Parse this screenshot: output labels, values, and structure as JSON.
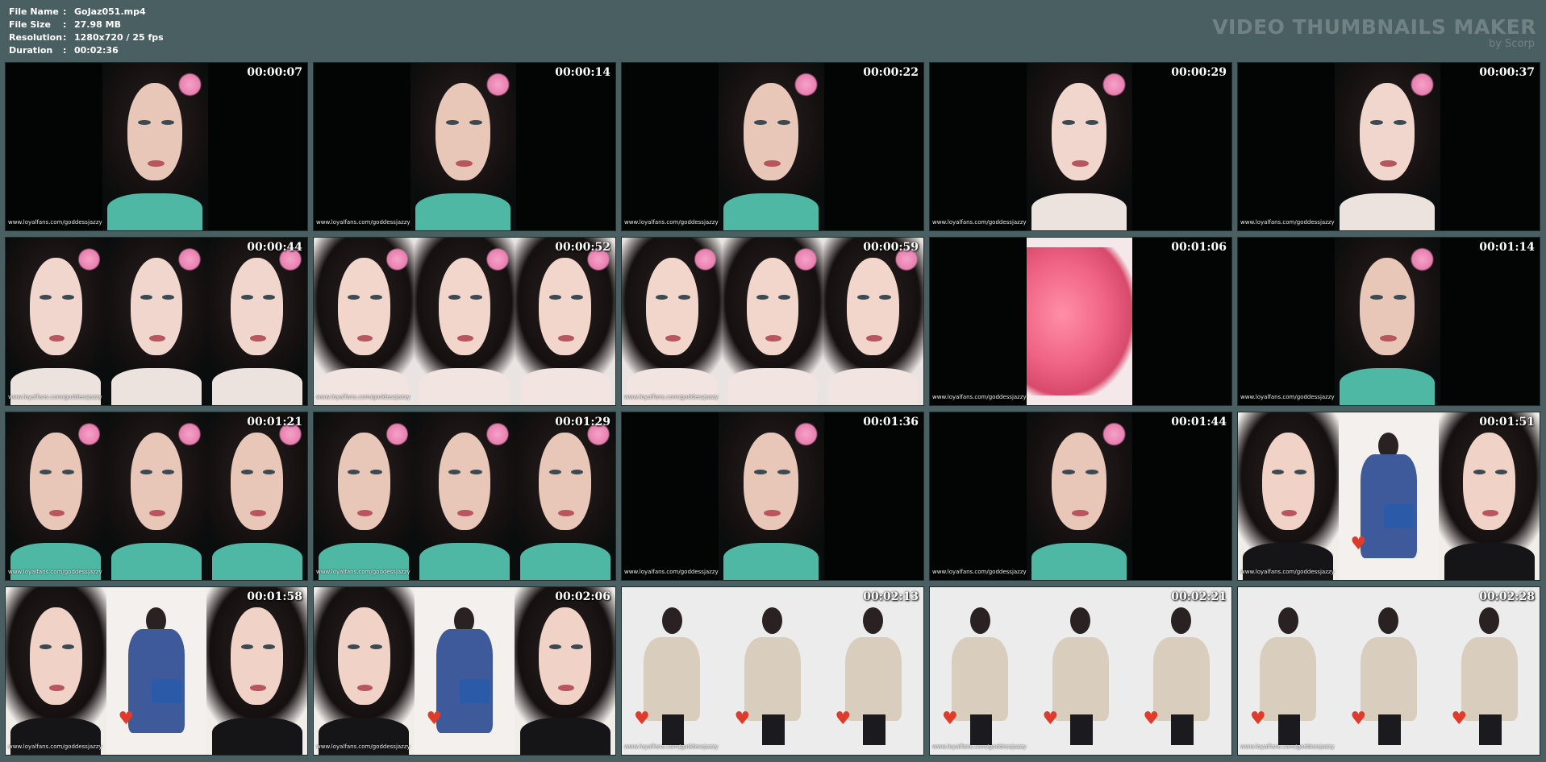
{
  "info": {
    "file_name_label": "File Name",
    "file_name": "GoJaz051.mp4",
    "file_size_label": "File Size",
    "file_size": "27.98 MB",
    "resolution_label": "Resolution",
    "resolution": "1280x720 / 25 fps",
    "duration_label": "Duration",
    "duration": "00:02:36",
    "separator": ":"
  },
  "brand": {
    "title": "VIDEO THUMBNAILS MAKER",
    "subtitle": "by Scorp"
  },
  "colors": {
    "background": "#4a5f62",
    "frame_black": "#030505"
  },
  "watermark": "www.loyalfans.com/goddessjazzy",
  "thumbnails": [
    {
      "time": "00:00:07",
      "layout": "single",
      "scene": "teal"
    },
    {
      "time": "00:00:14",
      "layout": "single",
      "scene": "teal"
    },
    {
      "time": "00:00:22",
      "layout": "single",
      "scene": "teal"
    },
    {
      "time": "00:00:29",
      "layout": "single",
      "scene": "white"
    },
    {
      "time": "00:00:37",
      "layout": "single",
      "scene": "white"
    },
    {
      "time": "00:00:44",
      "layout": "triple",
      "scene": "white"
    },
    {
      "time": "00:00:52",
      "layout": "triple",
      "scene": "finger"
    },
    {
      "time": "00:00:59",
      "layout": "triple",
      "scene": "finger"
    },
    {
      "time": "00:01:06",
      "layout": "single",
      "scene": "pink"
    },
    {
      "time": "00:01:14",
      "layout": "single",
      "scene": "teal"
    },
    {
      "time": "00:01:21",
      "layout": "triple",
      "scene": "teal"
    },
    {
      "time": "00:01:29",
      "layout": "triple",
      "scene": "teal"
    },
    {
      "time": "00:01:36",
      "layout": "single",
      "scene": "teal"
    },
    {
      "time": "00:01:44",
      "layout": "single",
      "scene": "teal"
    },
    {
      "time": "00:01:51",
      "layout": "triple",
      "scene": "blazer"
    },
    {
      "time": "00:01:58",
      "layout": "triple",
      "scene": "blazer"
    },
    {
      "time": "00:02:06",
      "layout": "triple",
      "scene": "blazer"
    },
    {
      "time": "00:02:13",
      "layout": "triple",
      "scene": "coat"
    },
    {
      "time": "00:02:21",
      "layout": "triple",
      "scene": "coat"
    },
    {
      "time": "00:02:28",
      "layout": "triple",
      "scene": "coat"
    }
  ]
}
